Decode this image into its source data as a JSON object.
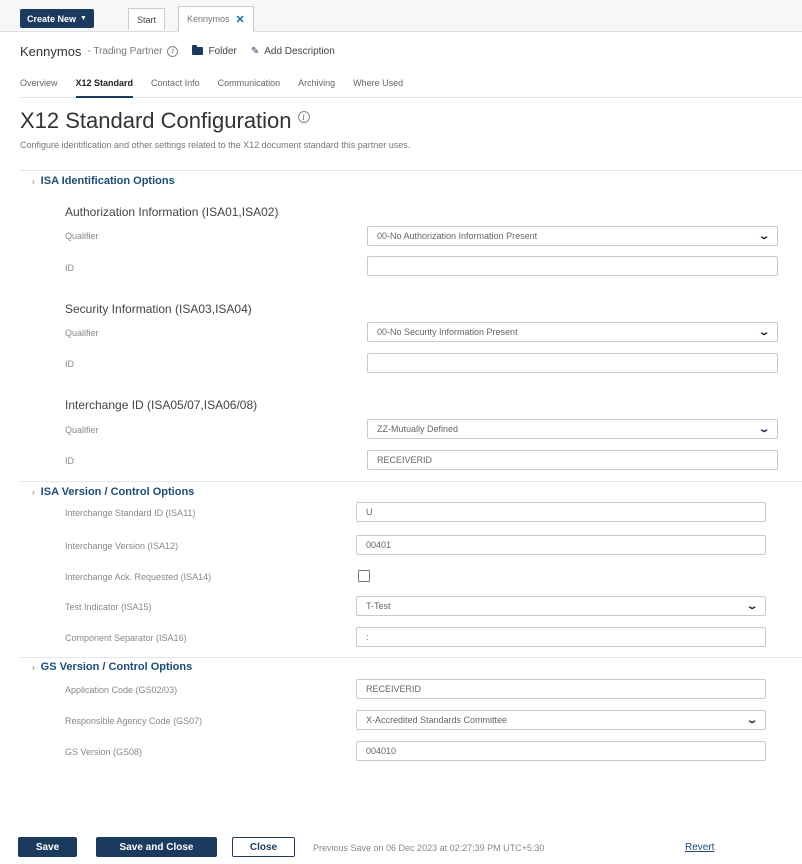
{
  "topbar": {
    "create_new_label": "Create New",
    "tab_start_label": "Start",
    "tab_active_label": "Kennymos"
  },
  "header": {
    "entity_name": "Kennymos",
    "entity_type": "- Trading Partner",
    "folder_label": "Folder",
    "add_description_label": "Add Description"
  },
  "nav": {
    "tabs": [
      {
        "label": "Overview"
      },
      {
        "label": "X12 Standard"
      },
      {
        "label": "Contact Info"
      },
      {
        "label": "Communication"
      },
      {
        "label": "Archiving"
      },
      {
        "label": "Where Used"
      }
    ]
  },
  "page": {
    "title": "X12 Standard Configuration",
    "description": "Configure identification and other settings related to the X12 document standard this partner uses."
  },
  "isa_identification": {
    "title": "ISA Identification Options",
    "authorization": {
      "title": "Authorization Information (ISA01,ISA02)",
      "qualifier_label": "Qualifier",
      "qualifier_value": "00-No Authorization Information Present",
      "id_label": "ID",
      "id_value": ""
    },
    "security": {
      "title": "Security Information (ISA03,ISA04)",
      "qualifier_label": "Qualifier",
      "qualifier_value": "00-No Security Information Present",
      "id_label": "ID",
      "id_value": ""
    },
    "interchange": {
      "title": "Interchange ID (ISA05/07,ISA06/08)",
      "qualifier_label": "Qualifier",
      "qualifier_value": "ZZ-Mutually Defined",
      "id_label": "ID",
      "id_value": "RECEIVERID"
    }
  },
  "isa_version": {
    "title": "ISA Version / Control Options",
    "standard_id_label": "Interchange Standard ID (ISA11)",
    "standard_id_value": "U",
    "version_label": "Interchange Version (ISA12)",
    "version_value": "00401",
    "ack_label": "Interchange Ack. Requested (ISA14)",
    "test_indicator_label": "Test Indicator (ISA15)",
    "test_indicator_value": "T-Test",
    "component_sep_label": "Component Separator (ISA16)",
    "component_sep_value": ":"
  },
  "gs_version": {
    "title": "GS Version / Control Options",
    "app_code_label": "Application Code (GS02/03)",
    "app_code_value": "RECEIVERID",
    "agency_label": "Responsible Agency Code (GS07)",
    "agency_value": "X-Accredited Standards Committee",
    "gs_version_label": "GS Version (GS08)",
    "gs_version_value": "004010"
  },
  "footer": {
    "save_label": "Save",
    "save_close_label": "Save and Close",
    "close_label": "Close",
    "status_text": "Previous Save on 06 Dec 2023 at 02:27:39 PM UTC+5:30",
    "revert_label": "Revert"
  },
  "colors": {
    "primary": "#1b3b5e",
    "link": "#1b4c7a"
  }
}
